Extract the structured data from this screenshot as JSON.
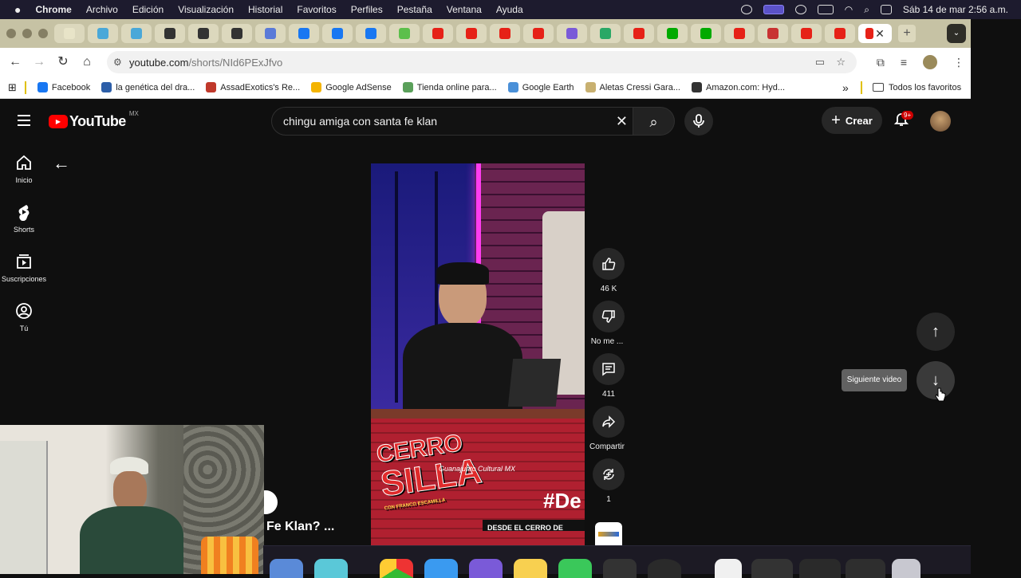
{
  "menubar": {
    "app": "Chrome",
    "menus": [
      "Archivo",
      "Edición",
      "Visualización",
      "Historial",
      "Favoritos",
      "Perfiles",
      "Pestaña",
      "Ventana",
      "Ayuda"
    ],
    "datetime": "Sáb 14 de mar  2:56 a.m."
  },
  "tabs": {
    "favicon_colors": [
      "#e8e4c8",
      "#4aa8d8",
      "#4aa8d8",
      "#333",
      "#333",
      "#333",
      "#5a7ad8",
      "#1877f2",
      "#1877f2",
      "#1877f2",
      "#5cbf4b",
      "#e62117",
      "#e62117",
      "#e62117",
      "#e62117",
      "#7a5ad8",
      "#2aa866",
      "#e62117",
      "#0a0",
      "#0a0",
      "#e62117",
      "#c83232",
      "#e62117",
      "#e62117"
    ],
    "active_close": "✕",
    "new_tab": "+"
  },
  "address": {
    "host": "youtube.com",
    "path": "/shorts/NId6PExJfvo"
  },
  "bookmarks": {
    "items": [
      {
        "label": "Facebook",
        "color": "#1877f2"
      },
      {
        "label": "la genética del dra...",
        "color": "#2c5ea8"
      },
      {
        "label": "AssadExotics's Re...",
        "color": "#c0392b"
      },
      {
        "label": "Google AdSense",
        "color": "#f4b400"
      },
      {
        "label": "Tienda online para...",
        "color": "#5aa05a"
      },
      {
        "label": "Google Earth",
        "color": "#4a90d8"
      },
      {
        "label": "Aletas Cressi Gara...",
        "color": "#c8b070"
      },
      {
        "label": "Amazon.com: Hyd...",
        "color": "#333333"
      }
    ],
    "overflow": "»",
    "all_label": "Todos los favoritos"
  },
  "youtube": {
    "logo_text": "YouTube",
    "region": "MX",
    "search_value": "chingu amiga con santa fe klan",
    "create_label": "Crear",
    "notif_badge": "9+",
    "sidebar": [
      {
        "label": "Inicio",
        "icon": "home-icon"
      },
      {
        "label": "Shorts",
        "icon": "shorts-icon"
      },
      {
        "label": "Suscripciones",
        "icon": "subscriptions-icon"
      },
      {
        "label": "Tú",
        "icon": "you-icon"
      }
    ],
    "actions": {
      "likes": "46 K",
      "dislike": "No me ...",
      "comments": "411",
      "share": "Compartir",
      "remix": "1"
    },
    "tooltip": "Siguiente video",
    "overlay_title": "Fe Klan? ..."
  },
  "video_overlay": {
    "channel_watermark": "Guanajuato Cultural MX",
    "hashtag": "#De",
    "subtitle": "DESDE EL CERRO DE",
    "show_logo_line1": "CERRO",
    "show_logo_line2": "SILLA",
    "host": "CON FRANCO ESCAMILLA"
  }
}
